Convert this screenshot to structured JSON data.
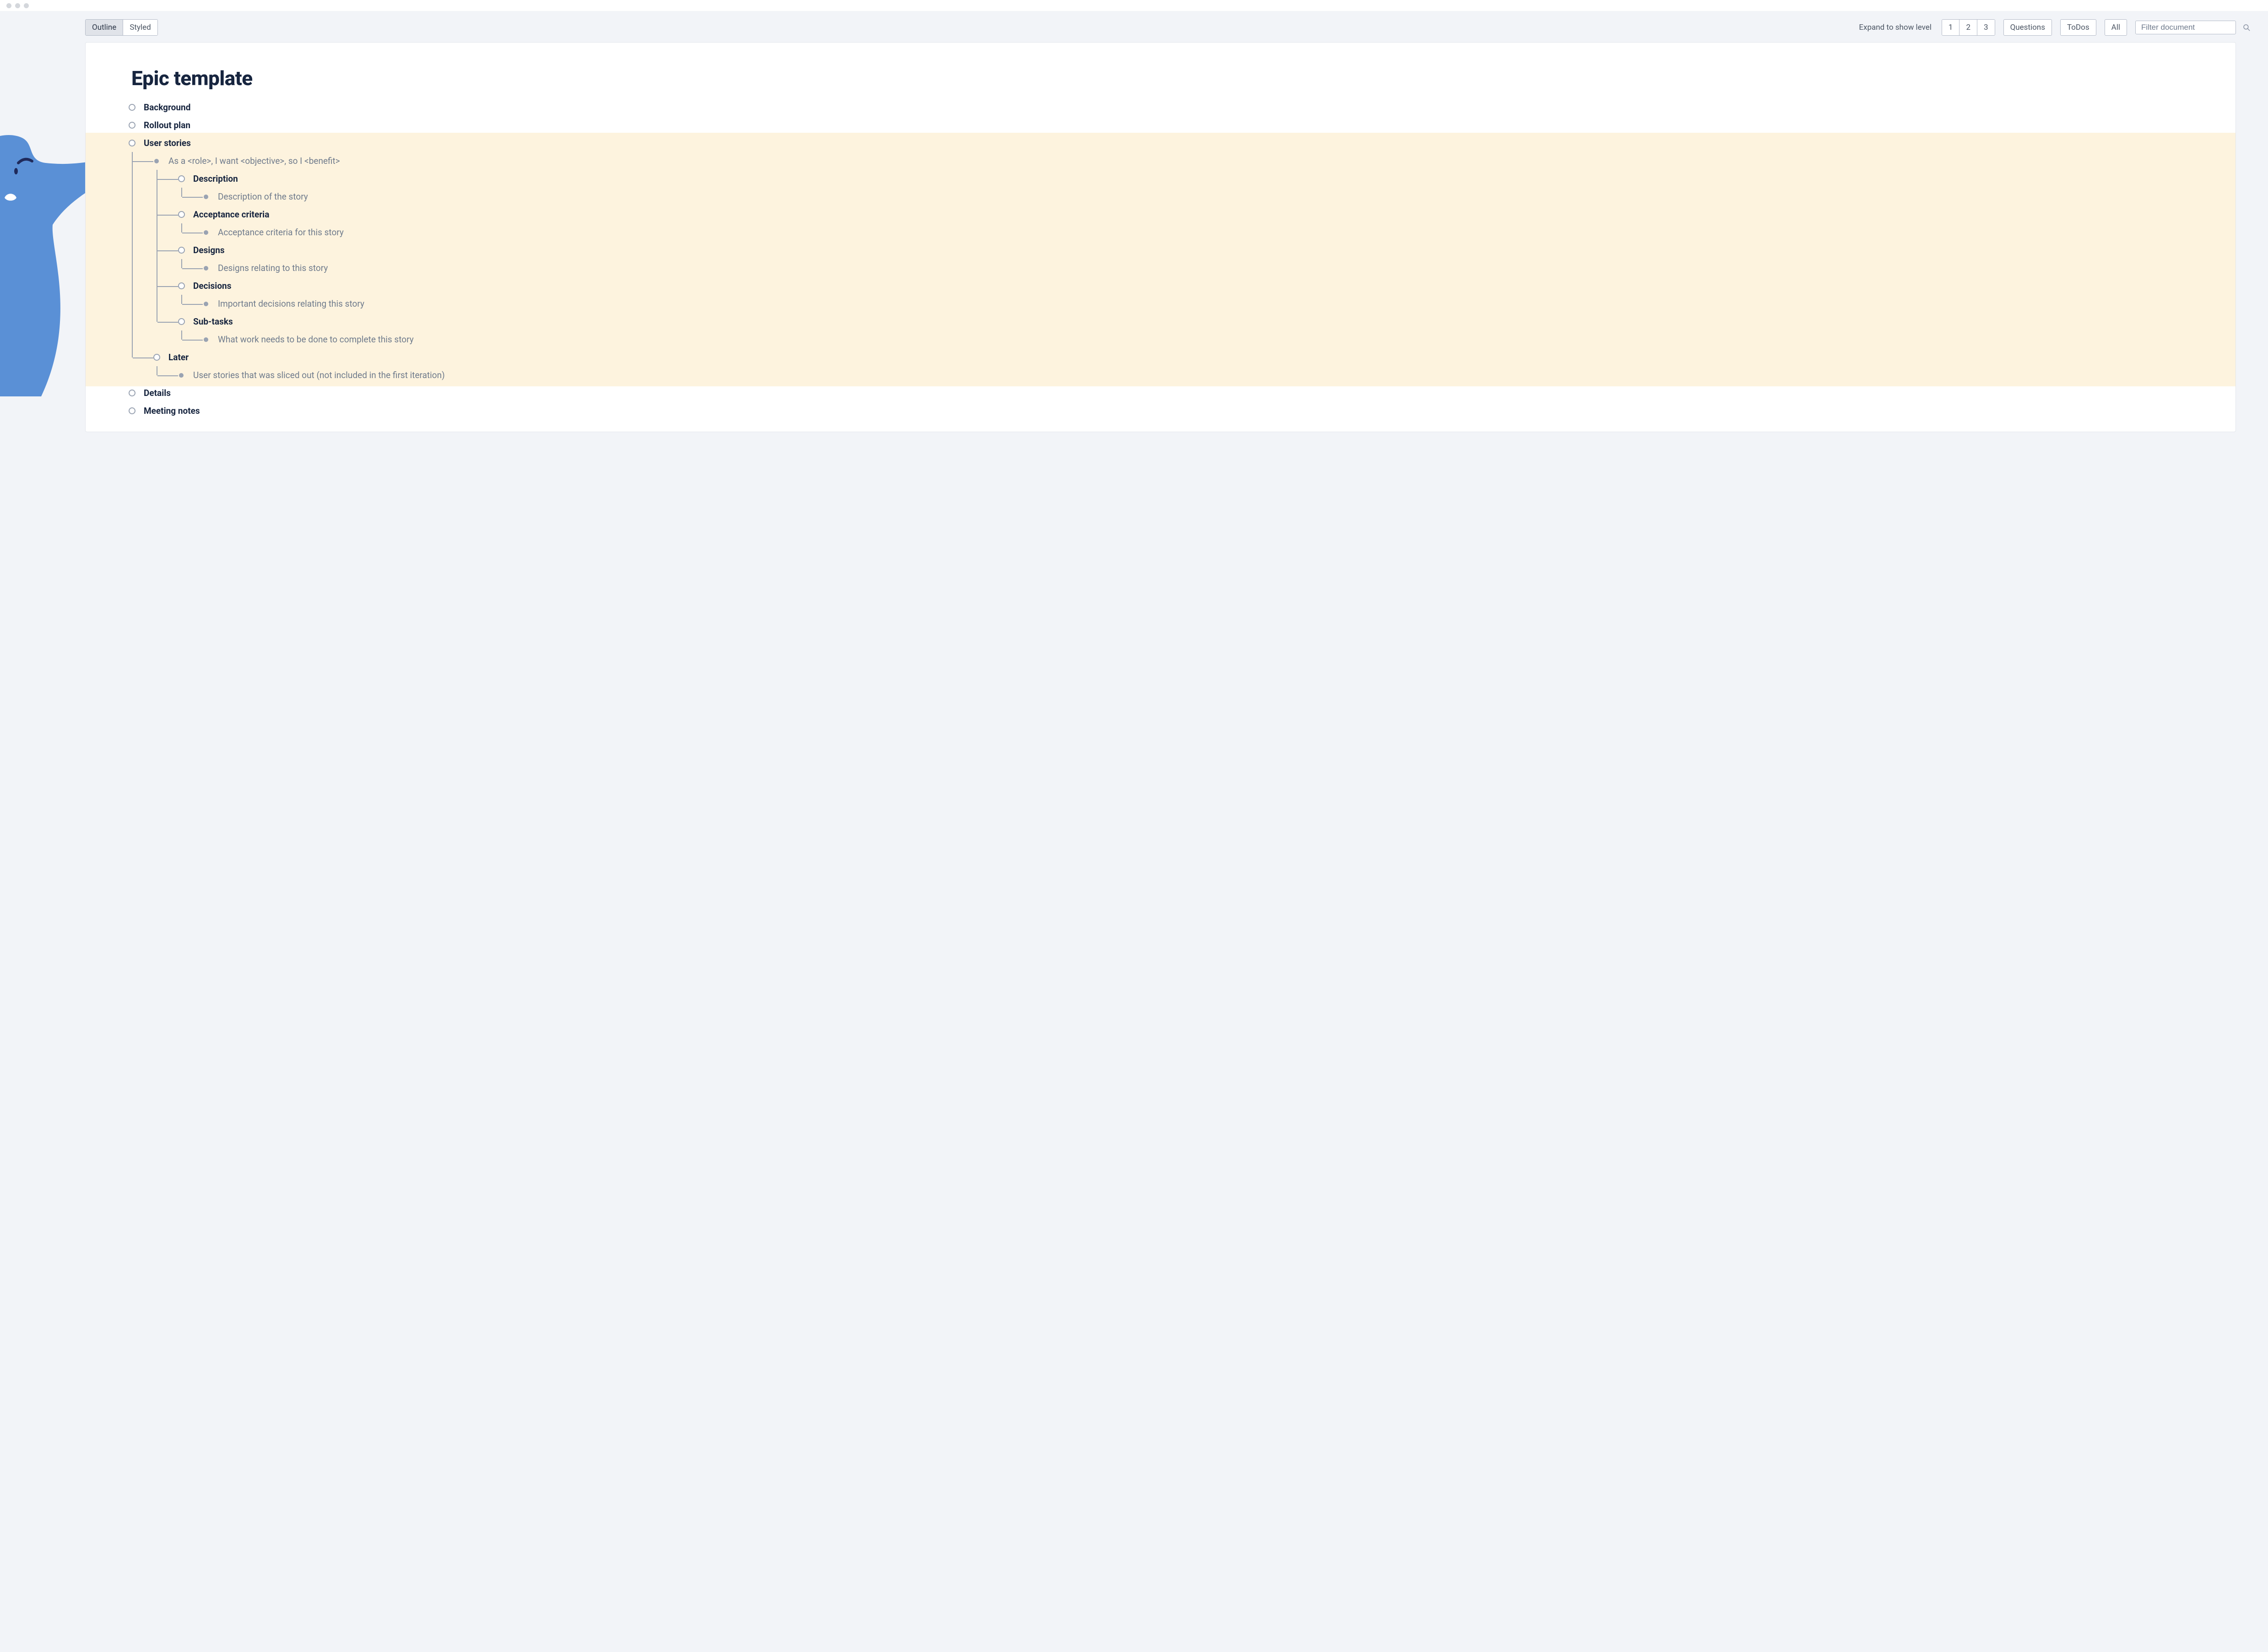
{
  "chrome": {
    "dot_count": 3
  },
  "toolbar": {
    "view_tabs": {
      "outline": "Outline",
      "styled": "Styled",
      "active": "outline"
    },
    "expand_label": "Expand to show level",
    "levels": [
      "1",
      "2",
      "3"
    ],
    "questions": "Questions",
    "todos": "ToDos",
    "all": "All",
    "filter_placeholder": "Filter document"
  },
  "document": {
    "title": "Epic template",
    "outline": [
      {
        "label": "Background",
        "type": "branch"
      },
      {
        "label": "Rollout plan",
        "type": "branch"
      },
      {
        "label": "User stories",
        "type": "branch",
        "highlighted": true,
        "children": [
          {
            "label": "As a <role>, I want <objective>, so I <benefit>",
            "type": "leaf",
            "children": [
              {
                "label": "Description",
                "type": "branch",
                "children": [
                  {
                    "label": "Description of the story",
                    "type": "leaf"
                  }
                ]
              },
              {
                "label": "Acceptance criteria",
                "type": "branch",
                "children": [
                  {
                    "label": "Acceptance criteria for this story",
                    "type": "leaf"
                  }
                ]
              },
              {
                "label": "Designs",
                "type": "branch",
                "children": [
                  {
                    "label": "Designs relating to this story",
                    "type": "leaf"
                  }
                ]
              },
              {
                "label": "Decisions",
                "type": "branch",
                "children": [
                  {
                    "label": "Important decisions relating this story",
                    "type": "leaf"
                  }
                ]
              },
              {
                "label": "Sub-tasks",
                "type": "branch",
                "children": [
                  {
                    "label": "What work needs to be done to complete this story",
                    "type": "leaf"
                  }
                ]
              }
            ]
          },
          {
            "label": "Later",
            "type": "branch",
            "children": [
              {
                "label": "User stories that was sliced out (not included in the first iteration)",
                "type": "leaf"
              }
            ]
          }
        ]
      },
      {
        "label": "Details",
        "type": "branch"
      },
      {
        "label": "Meeting notes",
        "type": "branch"
      }
    ]
  },
  "colors": {
    "highlight_bg": "#fdf3de",
    "text_dark": "#17253f",
    "text_muted": "#6f7b8c",
    "line": "#9aa3b2",
    "figure_fill": "#5a90d6",
    "figure_dark": "#1f2a5b"
  }
}
